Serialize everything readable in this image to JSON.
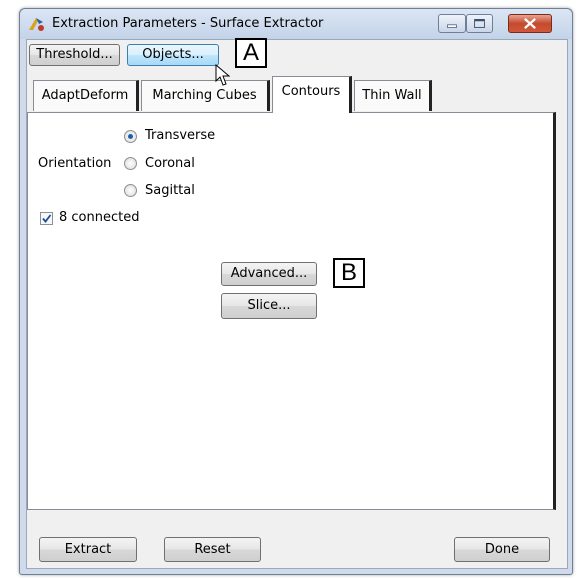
{
  "window": {
    "title": "Extraction Parameters - Surface Extractor"
  },
  "toolbar": {
    "threshold_label": "Threshold...",
    "objects_label": "Objects..."
  },
  "tabs": [
    {
      "label": "AdaptDeform",
      "active": false
    },
    {
      "label": "Marching Cubes",
      "active": false
    },
    {
      "label": "Contours",
      "active": true
    },
    {
      "label": "Thin Wall",
      "active": false
    }
  ],
  "contours": {
    "orientation_label": "Orientation",
    "options": [
      {
        "label": "Transverse",
        "selected": true
      },
      {
        "label": "Coronal",
        "selected": false
      },
      {
        "label": "Sagittal",
        "selected": false
      }
    ],
    "connected_label": "8 connected",
    "connected_checked": true,
    "advanced_label": "Advanced...",
    "slice_label": "Slice..."
  },
  "footer": {
    "extract_label": "Extract",
    "reset_label": "Reset",
    "done_label": "Done"
  },
  "callouts": {
    "a": "A",
    "b": "B"
  },
  "colors": {
    "close_button": "#c44a2e",
    "radio_selected": "#1d5fa8",
    "focus_button": "#3c7fb1"
  }
}
